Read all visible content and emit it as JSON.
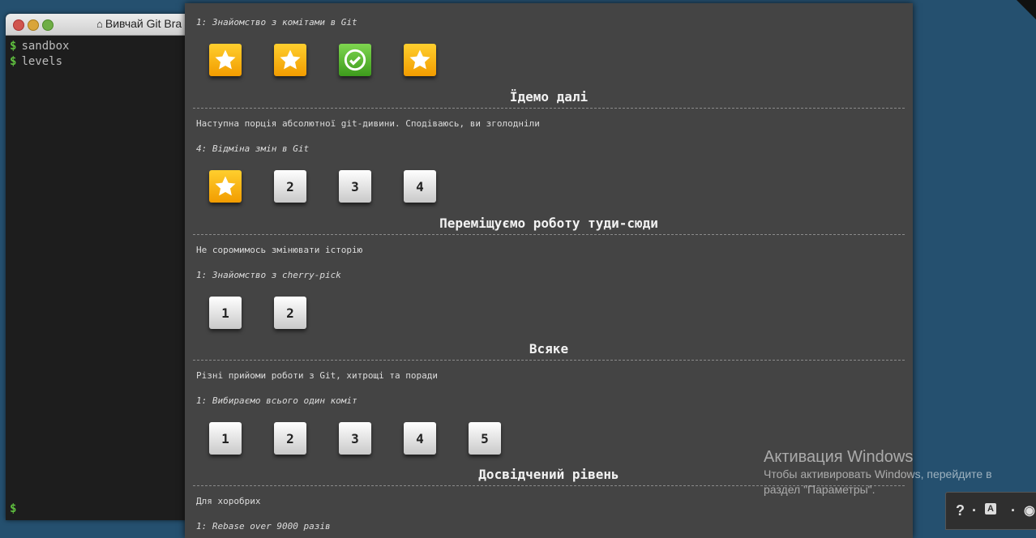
{
  "terminal": {
    "title": "Вивчай Git Bra",
    "lines": [
      {
        "prompt": "$",
        "text": "sandbox"
      },
      {
        "prompt": "$",
        "text": "levels"
      }
    ],
    "bottom_prompt": "$"
  },
  "levels": {
    "seq_intro": {
      "title": "1: Знайомство з комітами в Git",
      "items": [
        "star",
        "star",
        "done",
        "star"
      ]
    },
    "group_next": {
      "heading": "Їдемо далі",
      "description": "Наступна порція абсолютної git-дивини. Сподіваюсь, ви зголодніли",
      "seq_title": "4: Відміна змін в Git",
      "items": [
        "star",
        "2",
        "3",
        "4"
      ]
    },
    "group_move": {
      "heading": "Переміщуємо роботу туди-сюди",
      "description": "Не соромимось змінювати історію",
      "seq_title": "1: Знайомство з cherry-pick",
      "items": [
        "1",
        "2"
      ]
    },
    "group_misc": {
      "heading": "Всяке",
      "description": "Різні прийоми роботи з Git, хитрощі та поради",
      "seq_title": "1: Вибираємо всього один коміт",
      "items": [
        "1",
        "2",
        "3",
        "4",
        "5"
      ]
    },
    "group_advanced": {
      "heading": "Досвідчений рівень",
      "description": "Для хоробрих",
      "seq_title": "1: Rebase over 9000 разів"
    }
  },
  "activation": {
    "title": "Активация Windows",
    "line1": "Чтобы активировать Windows, перейдите в",
    "line2": "раздел \"Параметры\"."
  },
  "tray": {
    "help": "?",
    "sep": "·",
    "lang": "A",
    "sep2": "·"
  },
  "colors": {
    "background": "#25506f",
    "modal": "#444444",
    "star_tile": "#f5a800",
    "done_tile": "#4fae2a",
    "prompt_green": "#5fbf3f"
  }
}
